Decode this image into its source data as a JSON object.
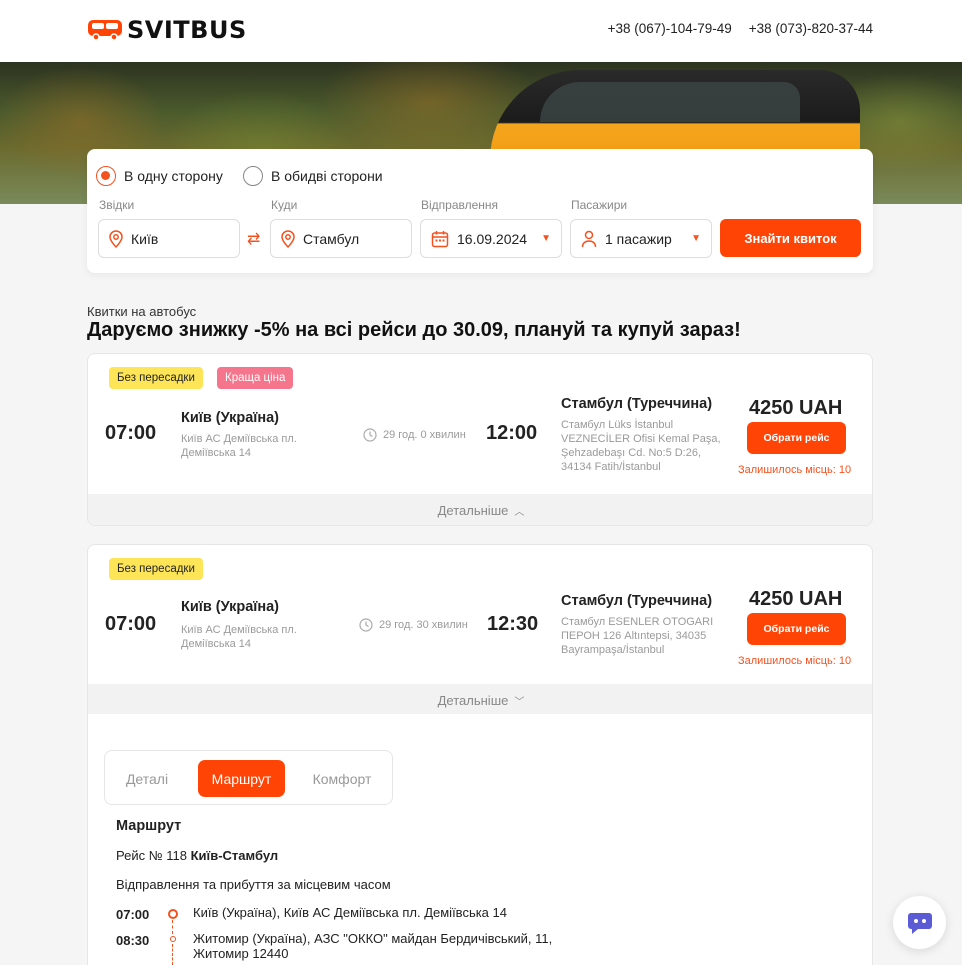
{
  "header": {
    "logo_text": "SVITBUS",
    "phone_1": "+38 (067)-104-79-49",
    "phone_2": "+38 (073)-820-37-44"
  },
  "search": {
    "one_way_label": "В одну сторону",
    "round_trip_label": "В обидві сторони",
    "from_label": "Звідки",
    "from_value": "Київ",
    "to_label": "Куди",
    "to_value": "Стамбул",
    "date_label": "Відправлення",
    "date_value": "16.09.2024",
    "passengers_label": "Пасажири",
    "passengers_value": "1 пасажир",
    "find_button": "Знайти квиток"
  },
  "promo": {
    "subtitle": "Квитки на автобус",
    "headline": "Даруємо знижку -5% на всі рейси до 30.09, плануй та купуй зараз!"
  },
  "trips": [
    {
      "badges": [
        "Без пересадки",
        "Краща ціна"
      ],
      "depart_time": "07:00",
      "depart_city": "Київ (Україна)",
      "depart_address": "Київ АС Деміївська пл. Деміївська 14",
      "duration": "29 год. 0 хвилин",
      "arrive_time": "12:00",
      "arrive_city": "Стамбул (Туреччина)",
      "arrive_address": "Стамбул Lüks İstanbul VEZNECİLER Ofisi Kemal Paşa, Şehzadebaşı Cd. No:5 D:26, 34134 Fatih/İstanbul",
      "price": "4250 UAH",
      "select_button": "Обрати рейс",
      "seats_left": "Залишилось місць: 10",
      "more_label": "Детальніше"
    },
    {
      "badges": [
        "Без пересадки"
      ],
      "depart_time": "07:00",
      "depart_city": "Київ (Україна)",
      "depart_address": "Київ АС Деміївська пл. Деміївська 14",
      "duration": "29 год. 30 хвилин",
      "arrive_time": "12:30",
      "arrive_city": "Стамбул (Туреччина)",
      "arrive_address": "Стамбул ESENLER OTOGARI ПЕРОН 126 Altıntepsi, 34035 Bayrampaşa/İstanbul",
      "price": "4250 UAH",
      "select_button": "Обрати рейс",
      "seats_left": "Залишилось місць: 10",
      "more_label": "Детальніше"
    }
  ],
  "details": {
    "tabs": [
      "Деталі",
      "Маршрут",
      "Комфорт"
    ],
    "active_tab": "Маршрут",
    "route_title": "Маршрут",
    "route_prefix": "Рейс № 118",
    "route_name": "Київ-Стамбул",
    "route_note": "Відправлення та прибуття за місцевим часом",
    "stops": [
      {
        "time": "07:00",
        "text": "Київ (Україна), Київ АС Деміївська пл. Деміївська 14"
      },
      {
        "time": "08:30",
        "text": "Житомир (Україна), АЗС \"ОККО\" майдан Бердичівський, 11, Житомир 12440"
      }
    ]
  },
  "colors": {
    "accent": "#ff4406",
    "badge_yellow": "#fde557",
    "badge_pink": "#f4758c",
    "chat_icon": "#5b5bd6"
  }
}
